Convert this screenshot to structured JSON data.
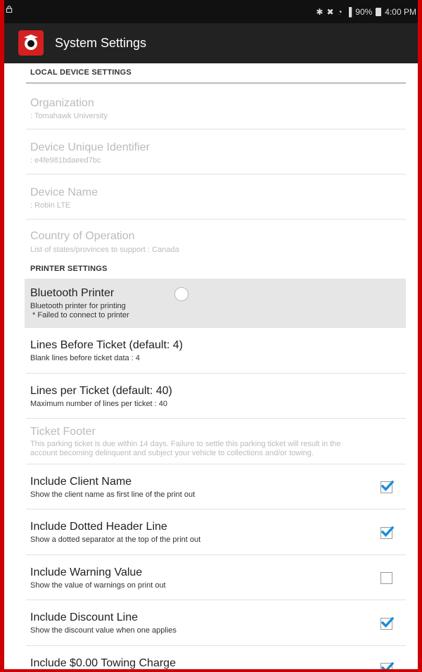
{
  "status": {
    "battery": "90%",
    "time": "4:00 PM"
  },
  "app": {
    "title": "System Settings"
  },
  "sections": {
    "local": "LOCAL DEVICE SETTINGS",
    "printer": "PRINTER SETTINGS"
  },
  "local_settings": [
    {
      "title": "Organization",
      "subtitle": ": Tomahawk University"
    },
    {
      "title": "Device Unique Identifier",
      "subtitle": ": e4fe981bdaeed7bc"
    },
    {
      "title": "Device Name",
      "subtitle": ": Robin LTE"
    },
    {
      "title": "Country of Operation",
      "subtitle": "List of states/provinces to support : Canada"
    }
  ],
  "bluetooth": {
    "title": "Bluetooth Printer",
    "subtitle": "Bluetooth printer for printing",
    "error": " * Failed to connect to printer"
  },
  "printer_settings": [
    {
      "title": "Lines Before Ticket (default: 4)",
      "subtitle": "Blank lines before ticket data : 4"
    },
    {
      "title": "Lines per Ticket (default: 40)",
      "subtitle": "Maximum number of lines per ticket : 40"
    }
  ],
  "footer": {
    "title": "Ticket Footer",
    "text1": "This parking ticket is due within 14 days. Failure to settle this parking ticket will result in the",
    "text2": "account becoming delinquent and subject your vehicle to collections and/or towing."
  },
  "options": [
    {
      "title": "Include Client Name",
      "subtitle": "Show the client name as first line of the print out",
      "checked": true
    },
    {
      "title": "Include Dotted Header Line",
      "subtitle": "Show a dotted separator at the top of the print out",
      "checked": true
    },
    {
      "title": "Include Warning Value",
      "subtitle": "Show the value of warnings on print out",
      "checked": false
    },
    {
      "title": "Include Discount Line",
      "subtitle": "Show the discount value when one applies",
      "checked": true
    },
    {
      "title": "Include $0.00 Towing Charge",
      "subtitle": "",
      "checked": true
    }
  ],
  "colors": {
    "accent": "#1a8fd6",
    "frame": "#cc0000",
    "appbar": "#222222"
  }
}
